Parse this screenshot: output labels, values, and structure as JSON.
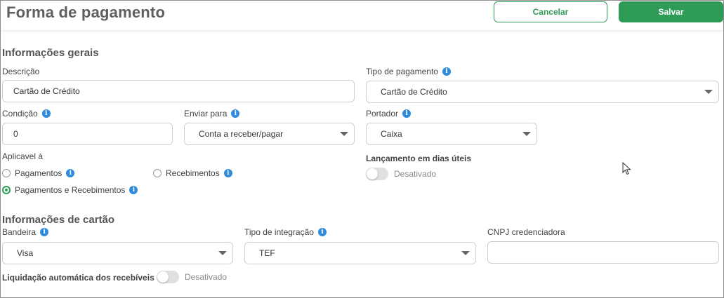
{
  "header": {
    "title": "Forma de pagamento",
    "cancel_label": "Cancelar",
    "save_label": "Salvar"
  },
  "general": {
    "section_title": "Informações gerais",
    "descricao": {
      "label": "Descrição",
      "value": "Cartão de Crédito"
    },
    "tipo_pagamento": {
      "label": "Tipo de pagamento",
      "value": "Cartão de Crédito"
    },
    "condicao": {
      "label": "Condição",
      "value": "0"
    },
    "enviar_para": {
      "label": "Enviar para",
      "value": "Conta a receber/pagar"
    },
    "portador": {
      "label": "Portador",
      "value": "Caixa"
    },
    "aplicavel": {
      "label": "Aplicavel à",
      "options": [
        "Pagamentos",
        "Recebimentos",
        "Pagamentos e Recebimentos"
      ],
      "selected": "Pagamentos e Recebimentos"
    },
    "dias_uteis": {
      "label": "Lançamento em dias úteis",
      "state": "Desativado"
    }
  },
  "card": {
    "section_title": "Informações de cartão",
    "bandeira": {
      "label": "Bandeira",
      "value": "Visa"
    },
    "tipo_integracao": {
      "label": "Tipo de integração",
      "value": "TEF"
    },
    "cnpj": {
      "label": "CNPJ credenciadora",
      "value": ""
    },
    "liquidacao": {
      "label": "Liquidação automática dos recebíveis",
      "state": "Desativado"
    }
  },
  "colors": {
    "primary": "#2e9b57",
    "info": "#2f8bdb"
  }
}
